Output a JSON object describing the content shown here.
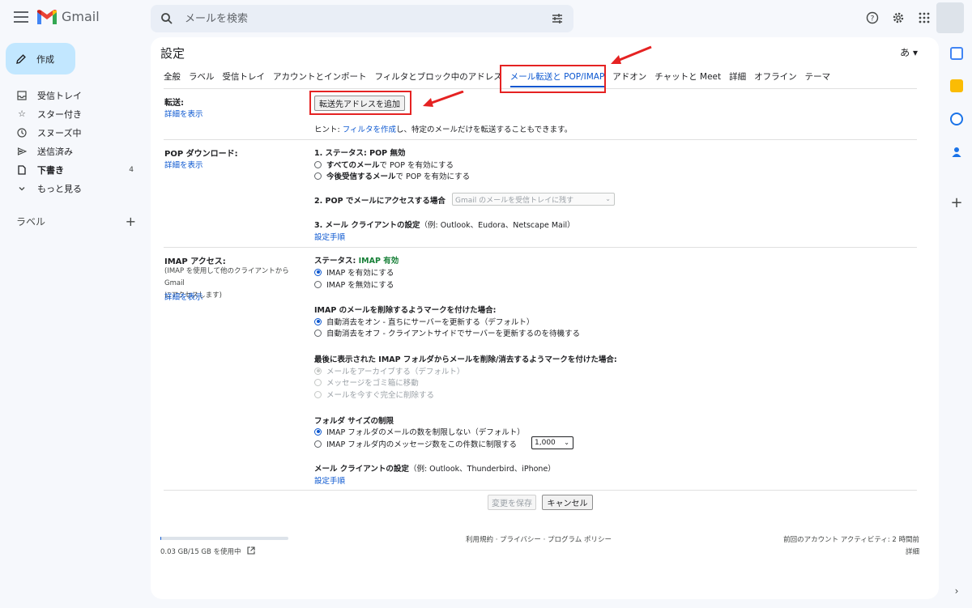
{
  "header": {
    "app_name": "Gmail",
    "search_placeholder": "メールを検索"
  },
  "sidebar": {
    "compose_label": "作成",
    "items": [
      {
        "label": "受信トレイ",
        "icon": "inbox-icon",
        "count": ""
      },
      {
        "label": "スター付き",
        "icon": "star-icon",
        "count": ""
      },
      {
        "label": "スヌーズ中",
        "icon": "clock-icon",
        "count": ""
      },
      {
        "label": "送信済み",
        "icon": "send-icon",
        "count": ""
      },
      {
        "label": "下書き",
        "icon": "draft-icon",
        "count": "4"
      },
      {
        "label": "もっと見る",
        "icon": "chevron-down-icon",
        "count": ""
      }
    ],
    "labels_heading": "ラベル",
    "labels_add": "+"
  },
  "settings": {
    "title": "設定",
    "ime_indicator": "あ",
    "tabs": [
      "全般",
      "ラベル",
      "受信トレイ",
      "アカウントとインポート",
      "フィルタとブロック中のアドレス",
      "メール転送と POP/IMAP",
      "アドオン",
      "チャットと Meet",
      "詳細",
      "オフライン",
      "テーマ"
    ],
    "forwarding": {
      "label": "転送:",
      "details_link": "詳細を表示",
      "add_button": "転送先アドレスを追加",
      "hint_prefix": "ヒント: ",
      "hint_link": "フィルタを作成",
      "hint_suffix": "し、特定のメールだけを転送することもできます。"
    },
    "pop": {
      "label": "POP ダウンロード:",
      "details_link": "詳細を表示",
      "status_title": "1. ステータス: POP 無効",
      "option1_bold": "すべてのメール",
      "option1_rest": "で POP を有効にする",
      "option2_bold": "今後受信するメール",
      "option2_rest": "で POP を有効にする",
      "access_title": "2. POP でメールにアクセスする場合",
      "access_select": "Gmail のメールを受信トレイに残す",
      "client_title": "3. メール クライアントの設定",
      "client_note": "（例: Outlook、Eudora、Netscape Mail）",
      "setup_link": "設定手順"
    },
    "imap": {
      "label": "IMAP アクセス:",
      "sub1": "(IMAP を使用して他のクライアントから Gmail",
      "sub2": "にアクセスします)",
      "details_link": "詳細を表示",
      "status_prefix": "ステータス: ",
      "status_value": "IMAP 有効",
      "enable": "IMAP を有効にする",
      "disable": "IMAP を無効にする",
      "delete_title": "IMAP のメールを削除するようマークを付けた場合:",
      "delete_opt1": "自動消去をオン - 直ちにサーバーを更新する（デフォルト）",
      "delete_opt2": "自動消去をオフ - クライアントサイドでサーバーを更新するのを待機する",
      "expunge_title": "最後に表示された IMAP フォルダからメールを削除/消去するようマークを付けた場合:",
      "expunge_opt1": "メールをアーカイブする（デフォルト）",
      "expunge_opt2": "メッセージをゴミ箱に移動",
      "expunge_opt3": "メールを今すぐ完全に削除する",
      "folder_title": "フォルダ サイズの制限",
      "folder_opt1": "IMAP フォルダのメールの数を制限しない（デフォルト）",
      "folder_opt2": "IMAP フォルダ内のメッセージ数をこの件数に制限する",
      "folder_limit": "1,000",
      "client_title": "メール クライアントの設定",
      "client_note": "（例: Outlook、Thunderbird、iPhone）",
      "setup_link": "設定手順"
    },
    "save_button": "変更を保存",
    "cancel_button": "キャンセル"
  },
  "footer": {
    "storage_used": 0.002,
    "storage": "0.03 GB/15 GB を使用中",
    "links": "利用規約 · プライバシー · プログラム ポリシー",
    "activity": "前回のアカウント アクティビティ: 2 時間前",
    "details": "詳細"
  },
  "colors": {
    "accent": "#0b57d0",
    "compose_bg": "#c2e7ff",
    "annotation": "#e52222",
    "status_green": "#188038"
  }
}
